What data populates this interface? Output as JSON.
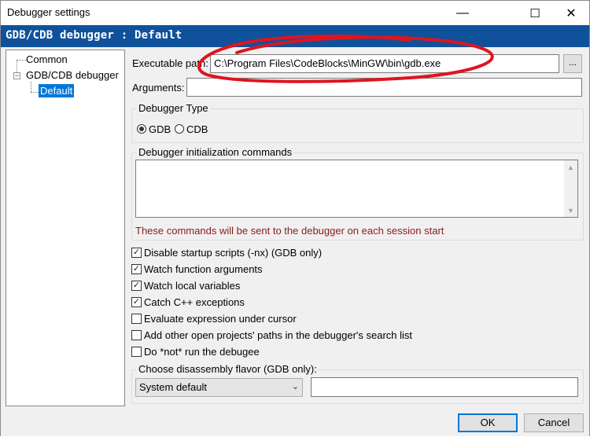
{
  "window": {
    "title": "Debugger settings",
    "controls": {
      "minimize": "—",
      "maximize": "☐",
      "close": "✕"
    }
  },
  "header": {
    "title": "GDB/CDB debugger : Default"
  },
  "tree": {
    "items": [
      "Common",
      "GDB/CDB debugger",
      "Default"
    ],
    "expander": "−"
  },
  "fields": {
    "executable_label": "Executable path:",
    "executable_value": "C:\\Program Files\\CodeBlocks\\MinGW\\bin\\gdb.exe",
    "browse_label": "...",
    "arguments_label": "Arguments:",
    "arguments_value": ""
  },
  "debugger_type": {
    "group_label": "Debugger Type",
    "options": [
      "GDB",
      "CDB"
    ],
    "selected": "GDB"
  },
  "init_commands": {
    "group_label": "Debugger initialization commands",
    "value": "",
    "note": "These commands will be sent to the debugger on each session start"
  },
  "checkboxes": [
    {
      "label": "Disable startup scripts (-nx) (GDB only)",
      "checked": true
    },
    {
      "label": "Watch function arguments",
      "checked": true
    },
    {
      "label": "Watch local variables",
      "checked": true
    },
    {
      "label": "Catch C++ exceptions",
      "checked": true
    },
    {
      "label": "Evaluate expression under cursor",
      "checked": false
    },
    {
      "label": "Add other open projects' paths in the debugger's search list",
      "checked": false
    },
    {
      "label": "Do *not* run the debugee",
      "checked": false
    }
  ],
  "disassembly": {
    "group_label": "Choose disassembly flavor (GDB only):",
    "selected": "System default",
    "extra_value": ""
  },
  "buttons": {
    "ok": "OK",
    "cancel": "Cancel"
  },
  "colors": {
    "header_bg": "#10519b",
    "selection": "#0078d7",
    "note": "#8b1a1a",
    "annotation": "#e0141e"
  }
}
